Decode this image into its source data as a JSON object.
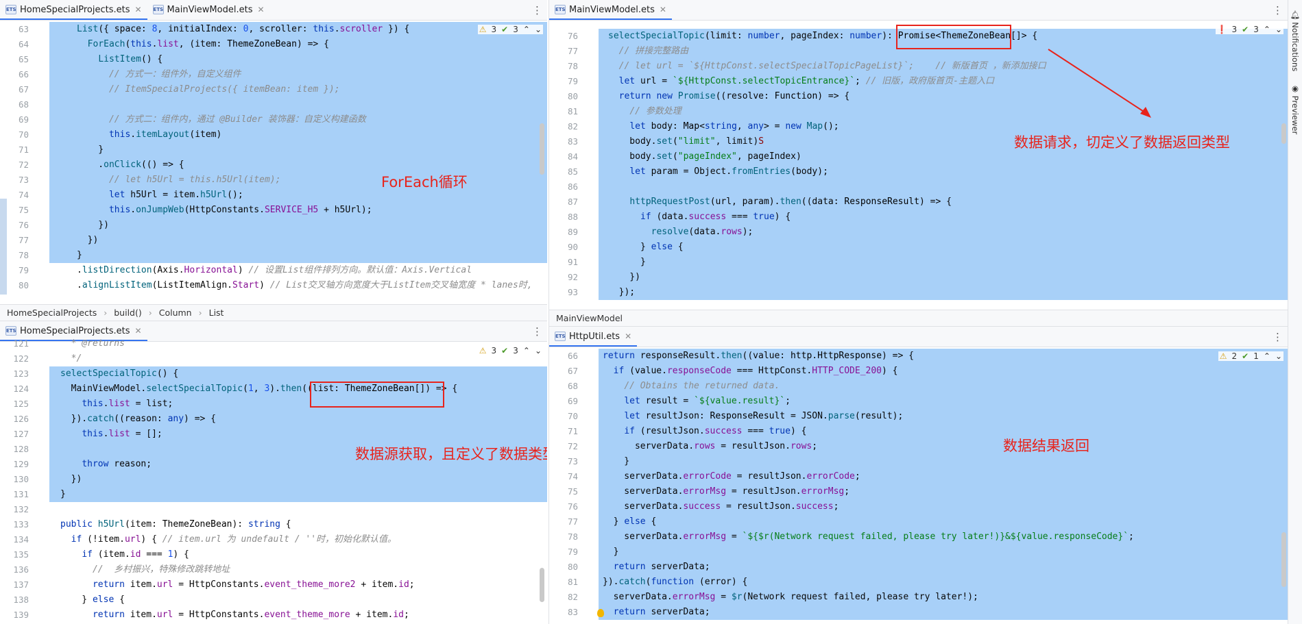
{
  "panes": {
    "top_left": {
      "tabs": [
        {
          "label": "HomeSpecialProjects.ets",
          "active": true
        },
        {
          "label": "MainViewModel.ets",
          "active": false
        }
      ],
      "inspect": {
        "warnings": "3",
        "checks": "3"
      },
      "lines": [
        {
          "n": "63",
          "hl": true,
          "html": "<span class=\"fn\">List</span>({ space: <span class=\"nm\">8</span>, initialIndex: <span class=\"nm\">0</span>, scroller: <span class=\"kw\">this</span>.<span class=\"pu\">scroller</span> }) {"
        },
        {
          "n": "64",
          "hl": true,
          "html": "  <span class=\"fn\">ForEach</span>(<span class=\"kw\">this</span>.<span class=\"pu\">list</span>, (item: <span class=\"ty\">ThemeZoneBean</span>) => {"
        },
        {
          "n": "65",
          "hl": true,
          "html": "    <span class=\"fn\">ListItem</span>() {"
        },
        {
          "n": "66",
          "hl": true,
          "html": "      <span class=\"cm\">// 方式一：组件外，自定义组件</span>"
        },
        {
          "n": "67",
          "hl": true,
          "html": "      <span class=\"cm\">// ItemSpecialProjects({ itemBean: item });</span>"
        },
        {
          "n": "68",
          "hl": true,
          "html": ""
        },
        {
          "n": "69",
          "hl": true,
          "html": "      <span class=\"cm\">// 方式二：组件内，通过 @Builder 装饰器：自定义构建函数</span>"
        },
        {
          "n": "70",
          "hl": true,
          "html": "      <span class=\"kw\">this</span>.<span class=\"fn\">itemLayout</span>(item)"
        },
        {
          "n": "71",
          "hl": true,
          "html": "    }"
        },
        {
          "n": "72",
          "hl": true,
          "html": "    .<span class=\"fn\">onClick</span>(() => {"
        },
        {
          "n": "73",
          "hl": true,
          "html": "      <span class=\"cm\">// let h5Url = this.h5Url(item);</span>"
        },
        {
          "n": "74",
          "hl": true,
          "html": "      <span class=\"kw\">let</span> h5Url = item.<span class=\"fn\">h5Url</span>();"
        },
        {
          "n": "75",
          "hl": true,
          "html": "      <span class=\"kw\">this</span>.<span class=\"fn\">onJumpWeb</span>(HttpConstants.<span class=\"pu\">SERVICE_H5</span> + h5Url);"
        },
        {
          "n": "76",
          "hl": true,
          "html": "    })"
        },
        {
          "n": "77",
          "hl": true,
          "html": "  })"
        },
        {
          "n": "78",
          "hl": true,
          "html": "}"
        },
        {
          "n": "79",
          "hl": false,
          "html": ".<span class=\"fn\">listDirection</span>(Axis.<span class=\"pu\">Horizontal</span>) <span class=\"cm\">// 设置List组件排列方向。默认值：Axis.Vertical</span>"
        },
        {
          "n": "80",
          "hl": false,
          "html": ".<span class=\"fn\">alignListItem</span>(ListItemAlign.<span class=\"pu\">Start</span>) <span class=\"cm\">// List交叉轴方向宽度大于ListItem交叉轴宽度 * lanes时,</span>"
        }
      ],
      "breadcrumb": [
        "HomeSpecialProjects",
        "build()",
        "Column",
        "List"
      ],
      "annotation": "ForEach循环"
    },
    "bottom_left": {
      "tabs": [
        {
          "label": "HomeSpecialProjects.ets",
          "active": true
        }
      ],
      "inspect": {
        "warnings": "3",
        "checks": "3"
      },
      "lines": [
        {
          "n": "121",
          "hl": false,
          "html": "  <span class=\"cm\">* @returns</span>"
        },
        {
          "n": "122",
          "hl": false,
          "html": "  <span class=\"cm\">*/</span>"
        },
        {
          "n": "123",
          "hl": true,
          "html": "<span class=\"fn\">selectSpecialTopic</span>() {"
        },
        {
          "n": "124",
          "hl": true,
          "html": "  MainViewModel.<span class=\"fn\">selectSpecialTopic</span>(<span class=\"nm\">1</span>, <span class=\"nm\">3</span>).<span class=\"fn\">then</span>((list: <span class=\"ty\">ThemeZoneBean</span>[]) => {"
        },
        {
          "n": "125",
          "hl": true,
          "html": "    <span class=\"kw\">this</span>.<span class=\"pu\">list</span> = list;"
        },
        {
          "n": "126",
          "hl": true,
          "html": "  }).<span class=\"fn\">catch</span>((reason: <span class=\"kw\">any</span>) => {"
        },
        {
          "n": "127",
          "hl": true,
          "html": "    <span class=\"kw\">this</span>.<span class=\"pu\">list</span> = [];"
        },
        {
          "n": "128",
          "hl": true,
          "html": ""
        },
        {
          "n": "129",
          "hl": true,
          "html": "    <span class=\"kw\">throw</span> reason;"
        },
        {
          "n": "130",
          "hl": true,
          "html": "  })"
        },
        {
          "n": "131",
          "hl": true,
          "html": "}"
        },
        {
          "n": "132",
          "hl": false,
          "html": ""
        },
        {
          "n": "133",
          "hl": false,
          "html": "<span class=\"kw\">public</span> <span class=\"fn\">h5Url</span>(item: <span class=\"ty\">ThemeZoneBean</span>): <span class=\"kw\">string</span> {"
        },
        {
          "n": "134",
          "hl": false,
          "html": "  <span class=\"kw\">if</span> (!item.<span class=\"pu\">url</span>) { <span class=\"cm\">// item.url 为 undefault / ''时，初始化默认值。</span>"
        },
        {
          "n": "135",
          "hl": false,
          "html": "    <span class=\"kw\">if</span> (item.<span class=\"pu\">id</span> === <span class=\"nm\">1</span>) {"
        },
        {
          "n": "136",
          "hl": false,
          "html": "      <span class=\"cm\">//  乡村振兴，特殊修改跳转地址</span>"
        },
        {
          "n": "137",
          "hl": false,
          "html": "      <span class=\"kw\">return</span> item.<span class=\"pu\">url</span> = HttpConstants.<span class=\"pu\">event_theme_more2</span> + item.<span class=\"pu\">id</span>;"
        },
        {
          "n": "138",
          "hl": false,
          "html": "    } <span class=\"kw\">else</span> {"
        },
        {
          "n": "139",
          "hl": false,
          "html": "      <span class=\"kw\">return</span> item.<span class=\"pu\">url</span> = HttpConstants.<span class=\"pu\">event_theme_more</span> + item.<span class=\"pu\">id</span>;"
        }
      ],
      "annotation": "数据源获取，且定义了数据类型"
    },
    "top_right": {
      "tabs": [
        {
          "label": "MainViewModel.ets",
          "active": true
        }
      ],
      "inspect": {
        "errors": "3",
        "checks": "3"
      },
      "lines": [
        {
          "n": "76",
          "hl": true,
          "html": "<span class=\"fn\">selectSpecialTopic</span>(limit: <span class=\"kw\">number</span>, pageIndex: <span class=\"kw\">number</span>): <span class=\"ty\">Promise</span>&lt;<span class=\"ty\">ThemeZoneBean</span>[]&gt; {"
        },
        {
          "n": "77",
          "hl": true,
          "html": "  <span class=\"cm\">// 拼接完整路由</span>"
        },
        {
          "n": "78",
          "hl": true,
          "html": "  <span class=\"cm\">// let url = `${HttpConst.selectSpecialTopicPageList}`;    // 新版首页 ，新添加接口</span>"
        },
        {
          "n": "79",
          "hl": true,
          "html": "  <span class=\"kw\">let</span> url = <span class=\"st\">`${HttpConst.selectTopicEntrance}`</span>; <span class=\"cm\">// 旧版，政府版首页-主题入口</span>"
        },
        {
          "n": "80",
          "hl": true,
          "html": "  <span class=\"kw\">return new</span> <span class=\"fn\">Promise</span>((resolve: <span class=\"ty\">Function</span>) => {"
        },
        {
          "n": "81",
          "hl": true,
          "html": "    <span class=\"cm\">// 参数处理</span>"
        },
        {
          "n": "82",
          "hl": true,
          "html": "    <span class=\"kw\">let</span> body: <span class=\"ty\">Map</span>&lt;<span class=\"kw\">string</span>, <span class=\"kw\">any</span>&gt; = <span class=\"kw\">new</span> <span class=\"fn\">Map</span>();"
        },
        {
          "n": "83",
          "hl": true,
          "html": "    body.<span class=\"fn\">set</span>(<span class=\"st\">\"limit\"</span>, limit)<span class=\"tp\">S</span>"
        },
        {
          "n": "84",
          "hl": true,
          "html": "    body.<span class=\"fn\">set</span>(<span class=\"st\">\"pageIndex\"</span>, pageIndex)"
        },
        {
          "n": "85",
          "hl": true,
          "html": "    <span class=\"kw\">let</span> param = Object.<span class=\"fn\">fromEntries</span>(body);"
        },
        {
          "n": "86",
          "hl": true,
          "html": ""
        },
        {
          "n": "87",
          "hl": true,
          "html": "    <span class=\"fn\">httpRequestPost</span>(url, param).<span class=\"fn\">then</span>((data: <span class=\"ty\">ResponseResult</span>) => {"
        },
        {
          "n": "88",
          "hl": true,
          "html": "      <span class=\"kw\">if</span> (data.<span class=\"pu\">success</span> === <span class=\"kw\">true</span>) {"
        },
        {
          "n": "89",
          "hl": true,
          "html": "        <span class=\"fn\">resolve</span>(data.<span class=\"pu\">rows</span>);"
        },
        {
          "n": "90",
          "hl": true,
          "html": "      } <span class=\"kw\">else</span> {"
        },
        {
          "n": "91",
          "hl": true,
          "html": "      }"
        },
        {
          "n": "92",
          "hl": true,
          "html": "    })"
        },
        {
          "n": "93",
          "hl": true,
          "html": "  });"
        }
      ],
      "breadcrumb": [
        "MainViewModel"
      ],
      "annotation": "数据请求，切定义了数据返回类型"
    },
    "bottom_right": {
      "tabs": [
        {
          "label": "HttpUtil.ets",
          "active": true
        }
      ],
      "inspect": {
        "warnings": "2",
        "checks": "1"
      },
      "lines": [
        {
          "n": "66",
          "hl": true,
          "html": "<span class=\"kw\">return</span> responseResult.<span class=\"fn\">then</span>((value: <span class=\"ty\">http.HttpResponse</span>) => {"
        },
        {
          "n": "67",
          "hl": true,
          "html": "  <span class=\"kw\">if</span> (value.<span class=\"pu\">responseCode</span> === HttpConst.<span class=\"pu\">HTTP_CODE_200</span>) {"
        },
        {
          "n": "68",
          "hl": true,
          "html": "    <span class=\"cm\">// Obtains the returned data.</span>"
        },
        {
          "n": "69",
          "hl": true,
          "html": "    <span class=\"kw\">let</span> result = <span class=\"st\">`${value.result}`</span>;"
        },
        {
          "n": "70",
          "hl": true,
          "html": "    <span class=\"kw\">let</span> resultJson: <span class=\"ty\">ResponseResult</span> = JSON.<span class=\"fn\">parse</span>(result);"
        },
        {
          "n": "71",
          "hl": true,
          "html": "    <span class=\"kw\">if</span> (resultJson.<span class=\"pu\">success</span> === <span class=\"kw\">true</span>) {"
        },
        {
          "n": "72",
          "hl": true,
          "html": "      serverData.<span class=\"pu\">rows</span> = resultJson.<span class=\"pu\">rows</span>;"
        },
        {
          "n": "73",
          "hl": true,
          "html": "    }"
        },
        {
          "n": "74",
          "hl": true,
          "html": "    serverData.<span class=\"pu\">errorCode</span> = resultJson.<span class=\"pu\">errorCode</span>;"
        },
        {
          "n": "75",
          "hl": true,
          "html": "    serverData.<span class=\"pu\">errorMsg</span> = resultJson.<span class=\"pu\">errorMsg</span>;"
        },
        {
          "n": "76",
          "hl": true,
          "html": "    serverData.<span class=\"pu\">success</span> = resultJson.<span class=\"pu\">success</span>;"
        },
        {
          "n": "77",
          "hl": true,
          "html": "  } <span class=\"kw\">else</span> {"
        },
        {
          "n": "78",
          "hl": true,
          "html": "    serverData.<span class=\"pu\">errorMsg</span> = <span class=\"st\">`${$r(Network request failed, please try later!)}&amp;${value.responseCode}`</span>;"
        },
        {
          "n": "79",
          "hl": true,
          "html": "  }"
        },
        {
          "n": "80",
          "hl": true,
          "html": "  <span class=\"kw\">return</span> serverData;"
        },
        {
          "n": "81",
          "hl": true,
          "html": "}).<span class=\"fn\">catch</span>(<span class=\"kw\">function</span> (error) {"
        },
        {
          "n": "82",
          "hl": true,
          "html": "  serverData.<span class=\"pu\">errorMsg</span> = <span class=\"fn\">$r</span>(Network request failed, please try later!);"
        },
        {
          "n": "83",
          "hl": true,
          "html": "  <span class=\"kw\">return</span> serverData;"
        }
      ],
      "annotation": "数据结果返回"
    }
  },
  "side_tools": {
    "notifications": "Notifications",
    "previewer": "Previewer"
  },
  "colors": {
    "accent": "#3574f0",
    "selection": "#a8d0f8",
    "annotation": "#e8231b"
  }
}
